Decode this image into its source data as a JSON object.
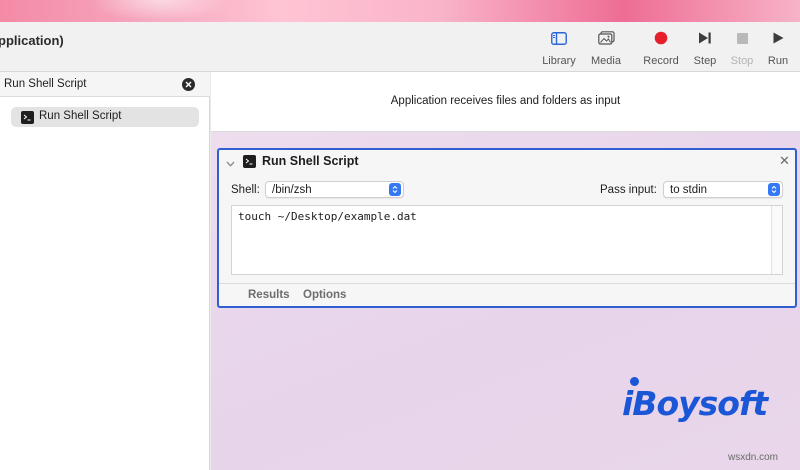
{
  "window": {
    "title": "pplication)"
  },
  "toolbar": {
    "library": "Library",
    "media": "Media",
    "record": "Record",
    "step": "Step",
    "stop": "Stop",
    "run": "Run"
  },
  "sidebar": {
    "search_value": "Run Shell Script",
    "result": "Run Shell Script"
  },
  "workflow": {
    "description": "Application receives files and folders as input"
  },
  "action": {
    "title": "Run Shell Script",
    "shell_label": "Shell:",
    "shell_value": "/bin/zsh",
    "pass_input_label": "Pass input:",
    "pass_input_value": "to stdin",
    "script": "touch ~/Desktop/example.dat",
    "tabs": [
      "Results",
      "Options"
    ]
  },
  "watermarks": {
    "brand": "iBoysoft",
    "site": "wsxdn.com"
  },
  "colors": {
    "accent": "#3478f6",
    "selection_border": "#2f5fd0",
    "record": "#e5202b",
    "brand": "#1a56d6"
  }
}
